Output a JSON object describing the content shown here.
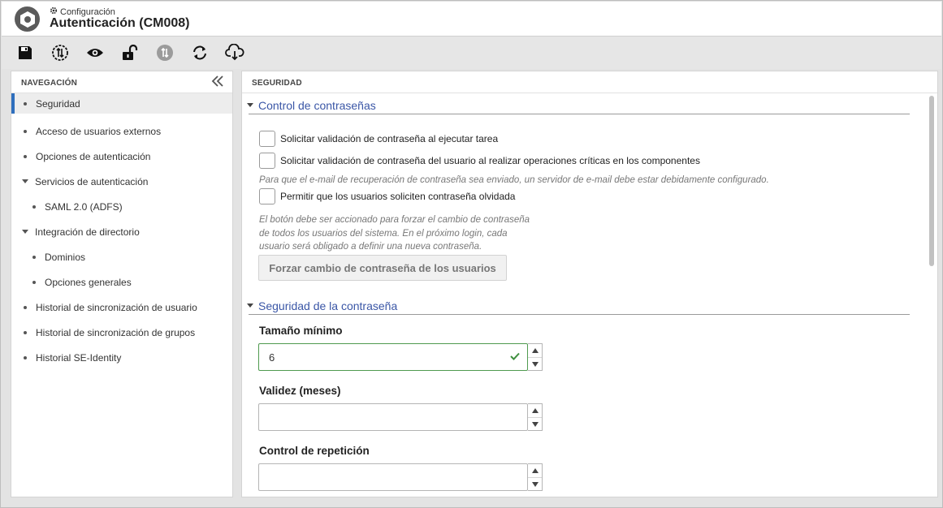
{
  "header": {
    "breadcrumb": "Configuración",
    "title": "Autenticación (CM008)",
    "app_icon": "settings-hex-icon"
  },
  "toolbar": {
    "buttons": [
      {
        "name": "save",
        "icon": "floppy-disk-icon"
      },
      {
        "name": "sync",
        "icon": "sync-circle-icon"
      },
      {
        "name": "view",
        "icon": "eye-icon"
      },
      {
        "name": "unlock",
        "icon": "unlock-icon"
      },
      {
        "name": "sync-disabled",
        "icon": "sync-disabled-icon"
      },
      {
        "name": "refresh",
        "icon": "refresh-icon"
      },
      {
        "name": "cloud-download",
        "icon": "cloud-download-icon"
      }
    ]
  },
  "navigation": {
    "title": "NAVEGACIÓN",
    "items": [
      {
        "label": "Seguridad"
      },
      {
        "label": "Acceso de usuarios externos"
      },
      {
        "label": "Opciones de autenticación"
      },
      {
        "label": "Servicios de autenticación"
      },
      {
        "label": "SAML 2.0 (ADFS)"
      },
      {
        "label": "Integración de directorio"
      },
      {
        "label": "Dominios"
      },
      {
        "label": "Opciones generales"
      },
      {
        "label": "Historial de sincronización de usuario"
      },
      {
        "label": "Historial de sincronización de grupos"
      },
      {
        "label": "Historial SE-Identity"
      }
    ]
  },
  "content": {
    "title": "SEGURIDAD",
    "password_control": {
      "title": "Control de contraseñas",
      "check1": "Solicitar validación de contraseña al ejecutar tarea",
      "check2": "Solicitar validación de contraseña del usuario al realizar operaciones críticas en los componentes",
      "hint1": "Para que el e-mail de recuperación de contraseña sea enviado, un servidor de e-mail debe estar debidamente configurado.",
      "check3": "Permitir que los usuarios soliciten contraseña olvidada",
      "hint2_line1": "El botón debe ser accionado para forzar el cambio de contraseña",
      "hint2_line2": "de todos los usuarios del sistema. En el próximo login, cada",
      "hint2_line3": "usuario será obligado a definir una nueva contraseña.",
      "force_button": "Forzar cambio de contraseña de los usuarios"
    },
    "password_security": {
      "title": "Seguridad de la contraseña",
      "min_size_label": "Tamaño mínimo",
      "min_size_value": "6",
      "validity_label": "Validez (meses)",
      "validity_value": "",
      "repetition_label": "Control de repetición",
      "repetition_value": ""
    }
  }
}
